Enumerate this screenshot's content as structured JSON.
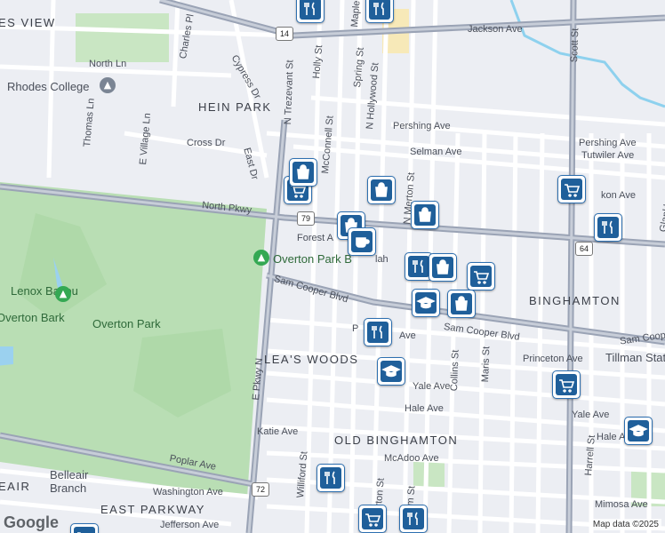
{
  "map": {
    "neighborhoods": [
      "HEIN PARK",
      "LEA'S WOODS",
      "OLD BINGHAMTON",
      "BINGHAMTON",
      "EAST PARKWAY",
      "ES VIEW",
      "EAIR"
    ],
    "parks": [
      "Overton Park",
      "Lenox Bayou"
    ],
    "pois": {
      "rhodes_college": "Rhodes College",
      "overton_park_pin": "Overton Park B",
      "belleair_branch_1": "Belleair",
      "belleair_branch_2": "Branch",
      "tillman_station": "Tillman Stati",
      "overton_bark": "Overton Bark"
    },
    "streets": [
      "Jackson Ave",
      "Charles Pl",
      "North Ln",
      "Cypress Dr",
      "N Trezevant St",
      "Holly St",
      "Maple",
      "Spring St",
      "N Hollywood St",
      "Pershing Ave",
      "Selman Ave",
      "Thomas Ln",
      "E Village Ln",
      "Cross Dr",
      "East Dr",
      "McConnell St",
      "N Merton St",
      "North Pkwy",
      "Forest A",
      "Sam Cooper Blvd",
      "E Pkwy N",
      "Collins St",
      "Maris St",
      "Scott St",
      "Princeton Ave",
      "Yale Ave",
      "Hale Ave",
      "Katie Ave",
      "McAdoo Ave",
      "Poplar Ave",
      "Williford St",
      "Washington Ave",
      "Jefferson Ave",
      "Harrell St",
      "Mimosa Ave",
      "Tutwiler Ave",
      "Pershing Ave",
      "Glankler St",
      "Sam Coop",
      "kon Ave",
      "Ave",
      "P",
      "Sam Cooper Blvd",
      "Yale Ave",
      "Hale Ave",
      "rton St",
      "am St",
      "lah"
    ],
    "route_shields": [
      "14",
      "79",
      "64",
      "72"
    ],
    "markers": [
      "restaurant",
      "restaurant",
      "grocery",
      "shopping",
      "shopping",
      "shopping",
      "cafe",
      "restaurant",
      "shopping",
      "grocery",
      "school",
      "shopping",
      "grocery",
      "restaurant",
      "restaurant",
      "school",
      "grocery",
      "school",
      "restaurant",
      "grocery",
      "restaurant",
      "grocery",
      "shopping"
    ],
    "attribution": "Map data ©2025",
    "google_logo": "Google"
  }
}
